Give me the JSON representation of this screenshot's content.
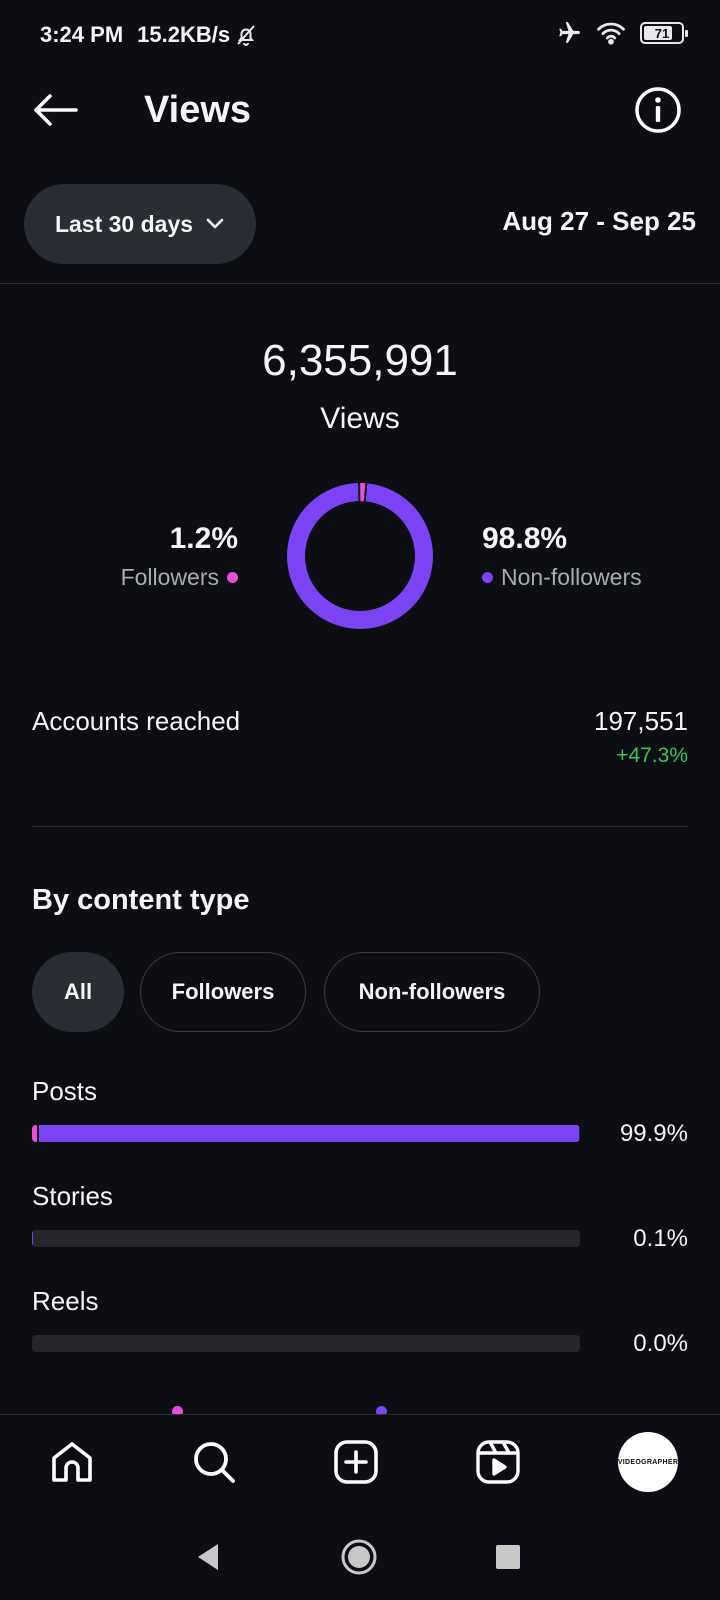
{
  "status_bar": {
    "time": "3:24 PM",
    "net_speed": "15.2KB/s",
    "battery": "71"
  },
  "header": {
    "title": "Views"
  },
  "period": {
    "label": "Last 30 days",
    "date_range": "Aug 27 - Sep 25"
  },
  "summary": {
    "total_views": "6,355,991",
    "views_label": "Views",
    "followers_pct": "1.2%",
    "followers_label": "Followers",
    "non_followers_pct": "98.8%",
    "non_followers_label": "Non-followers",
    "followers_share": 0.012
  },
  "accounts_reached": {
    "label": "Accounts reached",
    "value": "197,551",
    "change": "+47.3%"
  },
  "content_type": {
    "title": "By content type",
    "filters": [
      "All",
      "Followers",
      "Non-followers"
    ],
    "active_filter": "All",
    "rows": [
      {
        "label": "Posts",
        "pct": "99.9%",
        "share": 0.999,
        "followers_share": 0.012
      },
      {
        "label": "Stories",
        "pct": "0.1%",
        "share": 0.001,
        "followers_share": 0
      },
      {
        "label": "Reels",
        "pct": "0.0%",
        "share": 0.0,
        "followers_share": 0
      }
    ]
  },
  "colors": {
    "followers": "#e94fd6",
    "non_followers": "#7a44f5",
    "positive": "#3cc35a"
  },
  "bottom_nav": {
    "items": [
      "home-icon",
      "search-icon",
      "create-icon",
      "reels-icon",
      "profile-avatar"
    ]
  }
}
